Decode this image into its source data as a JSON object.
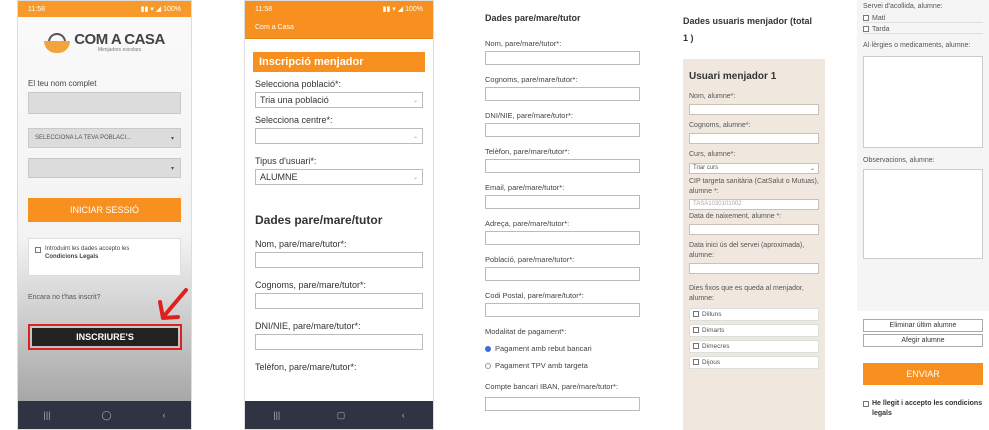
{
  "panel1": {
    "status_time": "11:58",
    "status_icons": "▮▮ ▾ ◢ 100%",
    "logo_title": "COM A CASA",
    "logo_subtitle": "Menjadors escolars",
    "name_label": "El teu nom complet",
    "select_town": "SELECCIONA LA TEVA POBLACI...",
    "login_button": "INICIAR SESSIÓ",
    "consent_text": "Introduint les dades accepto les",
    "consent_link": "Condicions Legals",
    "not_registered": "Encara no t'has inscrit?",
    "register_button": "INSCRIURE'S",
    "nav": [
      "|||",
      "◯",
      "‹"
    ]
  },
  "panel2": {
    "status_time": "11:58",
    "status_icons": "▮▮ ▾ ◢ 100%",
    "app_title": "Com a Casa",
    "form_title": "Inscripció menjador",
    "town_label": "Selecciona població*:",
    "town_value": "Tria una població",
    "centre_label": "Selecciona centre*:",
    "centre_value": "",
    "user_type_label": "Tipus d'usuari*:",
    "user_type_value": "ALUMNE",
    "section_title": "Dades pare/mare/tutor",
    "fields": [
      "Nom, pare/mare/tutor*:",
      "Cognoms, pare/mare/tutor*:",
      "DNI/NIE, pare/mare/tutor*:",
      "Telèfon, pare/mare/tutor*:"
    ],
    "nav": [
      "|||",
      "▢",
      "‹"
    ]
  },
  "panel3": {
    "title": "Dades pare/mare/tutor",
    "fields": [
      "Nom, pare/mare/tutor*:",
      "Cognoms, pare/mare/tutor*:",
      "DNI/NIE, pare/mare/tutor*:",
      "Telèfon, pare/mare/tutor*:",
      "Email, pare/mare/tutor*:",
      "Adreça, pare/mare/tutor*:",
      "Població, pare/mare/tutor*:",
      "Codi Postal, pare/mare/tutor*:"
    ],
    "payment_label": "Modalitat de pagament*:",
    "payment_options": [
      "Pagament amb rebut bancari",
      "Pagament TPV amb targeta"
    ],
    "iban_label": "Compte bancari IBAN, pare/mare/tutor*:"
  },
  "panel4": {
    "title": "Dades usuaris menjador (total  1 )",
    "user_title": "Usuari menjador 1",
    "name_label": "Nom, alumne*:",
    "surname_label": "Cognoms, alumne*:",
    "course_label": "Curs, alumne*:",
    "course_value": "Triar curs",
    "cip_label": "CIP targeta sanitària (CatSalut o Mutuas), alumne *:",
    "cip_placeholder": "TASA1030101002",
    "birth_label": "Data de naixement, alumne *:",
    "start_label": "Data inici ús del servei (aproximada), alumne:",
    "days_label": "Dies fixos que es queda al menjador, alumne:",
    "days": [
      "Dilluns",
      "Dimarts",
      "Dimecres",
      "Dijous"
    ]
  },
  "panel5": {
    "service_label": "Servei d'acollida, alumne:",
    "service_options": [
      "Matí",
      "Tarda"
    ],
    "allergies_label": "Al·lèrgies o medicaments, alumne:",
    "observations_label": "Observacions, alumne:",
    "remove_button": "Eliminar últim alumne",
    "add_button": "Afegir alumne",
    "send_button": "ENVIAR",
    "terms_text": "He llegit i accepto les condicions legals"
  }
}
